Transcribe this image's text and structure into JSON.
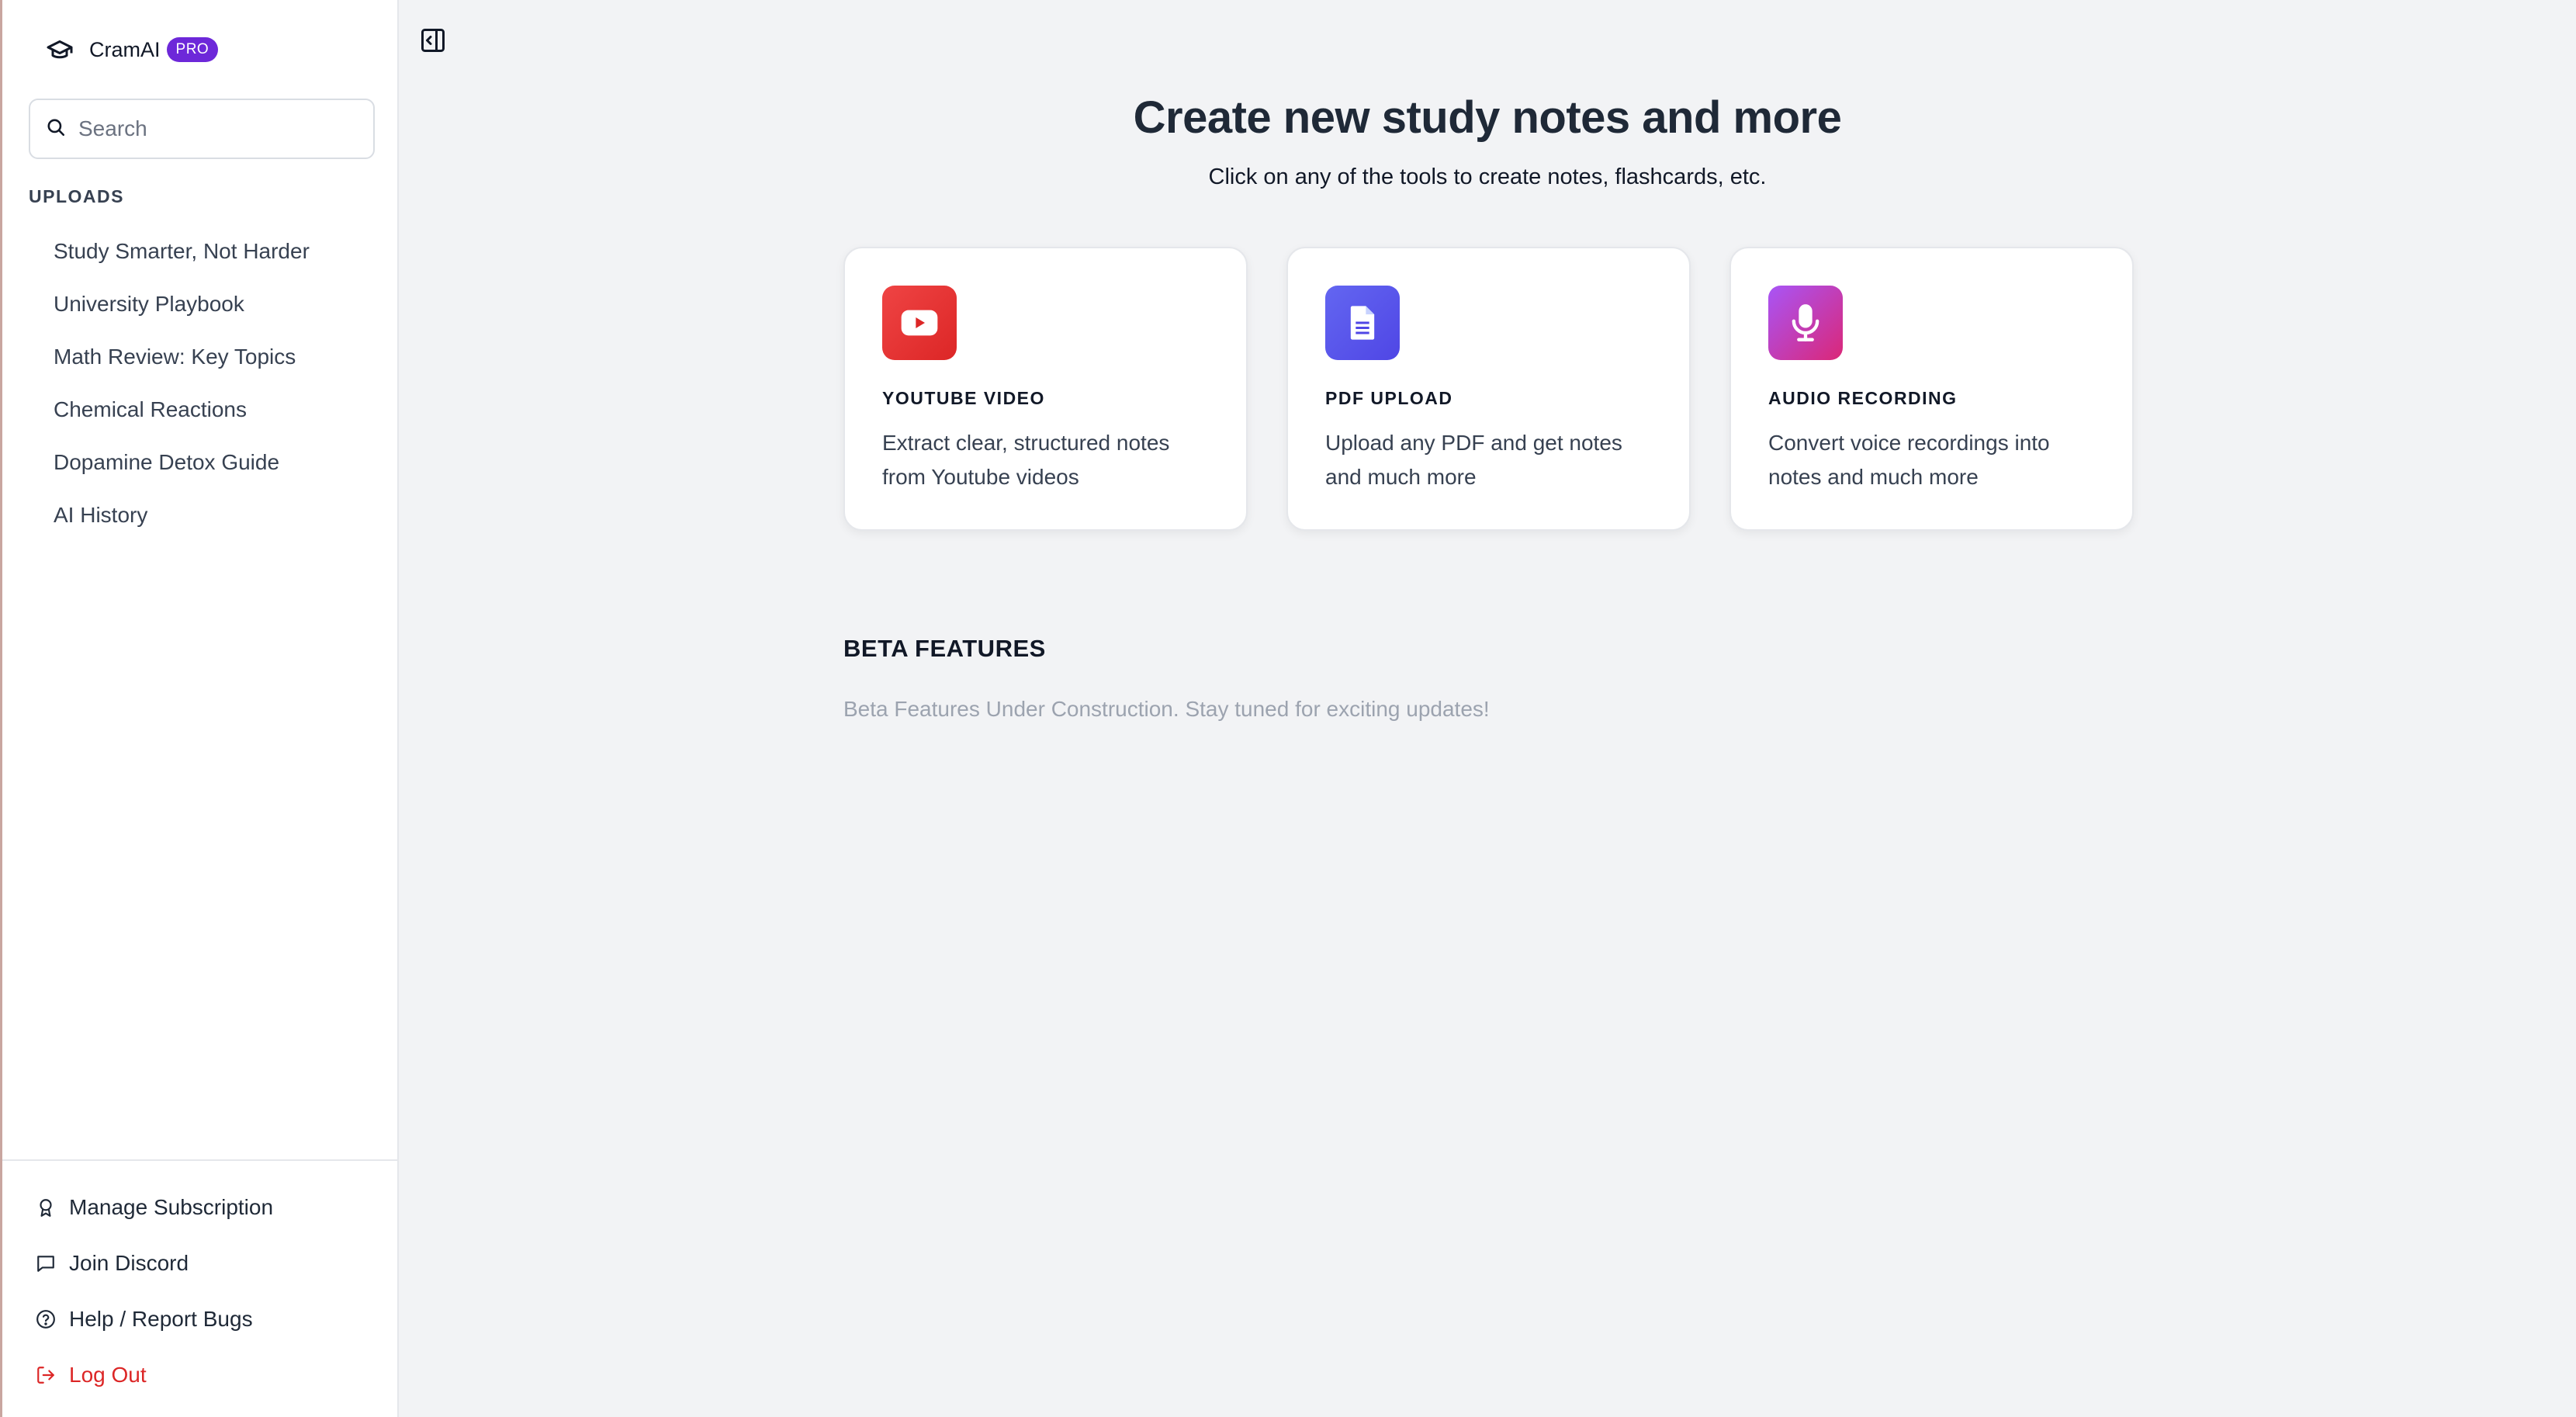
{
  "brand": {
    "name": "CramAI",
    "badge": "PRO"
  },
  "search": {
    "placeholder": "Search"
  },
  "uploads": {
    "title": "UPLOADS",
    "items": [
      "Study Smarter, Not Harder",
      "University Playbook",
      "Math Review: Key Topics",
      "Chemical Reactions",
      "Dopamine Detox Guide",
      "AI History"
    ]
  },
  "footer": {
    "manage": "Manage Subscription",
    "discord": "Join Discord",
    "help": "Help / Report Bugs",
    "logout": "Log Out"
  },
  "main": {
    "title": "Create new study notes and more",
    "subtitle": "Click on any of the tools to create notes, flashcards, etc.",
    "cards": [
      {
        "title": "YOUTUBE VIDEO",
        "desc": "Extract clear, structured notes from Youtube videos",
        "icon": "youtube-icon",
        "color": "#dc2626"
      },
      {
        "title": "PDF UPLOAD",
        "desc": "Upload any PDF and get notes and much more",
        "icon": "document-icon",
        "color": "#4f46e5"
      },
      {
        "title": "AUDIO RECORDING",
        "desc": "Convert voice recordings into notes and much more",
        "icon": "microphone-icon",
        "color": "#c026d3"
      }
    ],
    "beta_title": "BETA FEATURES",
    "beta_text": "Beta Features Under Construction. Stay tuned for exciting updates!"
  },
  "colors": {
    "accent": "#6d28d9",
    "danger": "#dc2626",
    "background": "#f2f3f5"
  }
}
